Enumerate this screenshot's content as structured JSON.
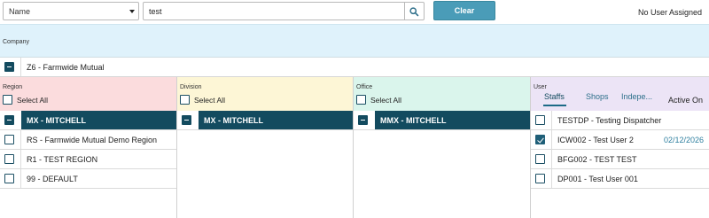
{
  "toolbar": {
    "filter_select": "Name",
    "search_value": "test",
    "search_placeholder": "",
    "clear_label": "Clear",
    "user_assigned_status": "No User Assigned"
  },
  "company": {
    "label": "Company",
    "item": "Z6 - Farmwide Mutual"
  },
  "region": {
    "label": "Region",
    "select_all": "Select All",
    "items": [
      "MX - MITCHELL",
      "RS - Farmwide Mutual Demo Region",
      "R1 - TEST REGION",
      "99 - DEFAULT"
    ]
  },
  "division": {
    "label": "Division",
    "select_all": "Select All",
    "items": [
      "MX - MITCHELL"
    ]
  },
  "office": {
    "label": "Office",
    "select_all": "Select All",
    "items": [
      "MMX - MITCHELL"
    ]
  },
  "user": {
    "label": "User",
    "tabs": [
      "Staffs",
      "Shops",
      "Indepe..."
    ],
    "active_on_label": "Active On",
    "items": [
      {
        "name": "TESTDP - Testing Dispatcher",
        "checked": false,
        "date": ""
      },
      {
        "name": "ICW002 - Test User 2",
        "checked": true,
        "date": "02/12/2026"
      },
      {
        "name": "BFG002 - TEST TEST",
        "checked": false,
        "date": ""
      },
      {
        "name": "DP001 - Test User 001",
        "checked": false,
        "date": ""
      }
    ]
  },
  "colors": {
    "accent": "#4a9cb8",
    "selected_row": "#134b5f",
    "company_band": "#dff2fb",
    "region_band": "#fbdcdd",
    "division_band": "#fdf6d6",
    "office_band": "#daf5ec",
    "user_band": "#ece4f6"
  }
}
